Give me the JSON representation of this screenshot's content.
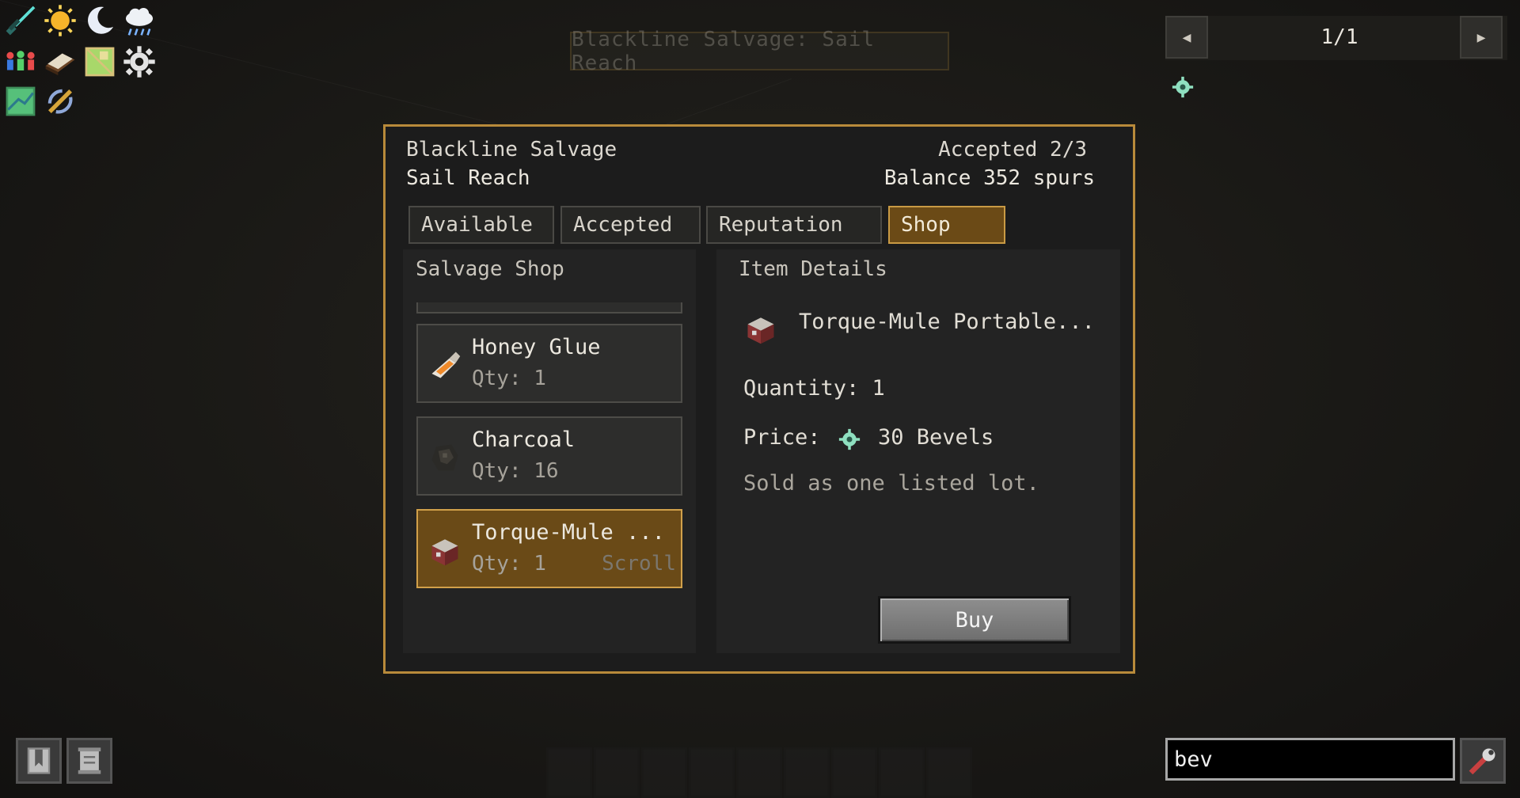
{
  "toolbar_icons": [
    {
      "name": "sword-icon"
    },
    {
      "name": "sun-icon"
    },
    {
      "name": "moon-icon"
    },
    {
      "name": "rain-cloud-icon"
    },
    {
      "name": "players-icon"
    },
    {
      "name": "book-icon"
    },
    {
      "name": "map-icon"
    },
    {
      "name": "gear-icon"
    },
    {
      "name": "biome-map-icon"
    },
    {
      "name": "compass-icon"
    }
  ],
  "ghost_title": "Blackline Salvage: Sail Reach",
  "pager": {
    "label": "1/1"
  },
  "dialog": {
    "faction": "Blackline Salvage",
    "location": "Sail Reach",
    "accepted": "Accepted 2/3",
    "balance": "Balance 352 spurs",
    "tabs": [
      {
        "label": "Available",
        "active": false
      },
      {
        "label": "Accepted",
        "active": false
      },
      {
        "label": "Reputation",
        "active": false
      },
      {
        "label": "Shop",
        "active": true
      }
    ],
    "shop": {
      "title": "Salvage Shop",
      "items": [
        {
          "name": "Honey Glue",
          "qty": "Qty: 1",
          "selected": false,
          "icon": "honey-glue-icon"
        },
        {
          "name": "Charcoal",
          "qty": "Qty: 16",
          "selected": false,
          "icon": "charcoal-icon"
        },
        {
          "name": "Torque-Mule ...",
          "qty": "Qty: 1",
          "selected": true,
          "icon": "torque-mule-icon",
          "hint": "Scroll"
        }
      ]
    },
    "details": {
      "title": "Item Details",
      "item_name": "Torque-Mule Portable...",
      "quantity": "Quantity: 1",
      "price_label": "Price:",
      "price_value": "30 Bevels",
      "note": "Sold as one listed lot.",
      "buy_label": "Buy"
    }
  },
  "search": {
    "value": "bev"
  },
  "colors": {
    "accent": "#b88a3a",
    "selected": "#6a4a17",
    "currency": "#8fe0c0"
  }
}
